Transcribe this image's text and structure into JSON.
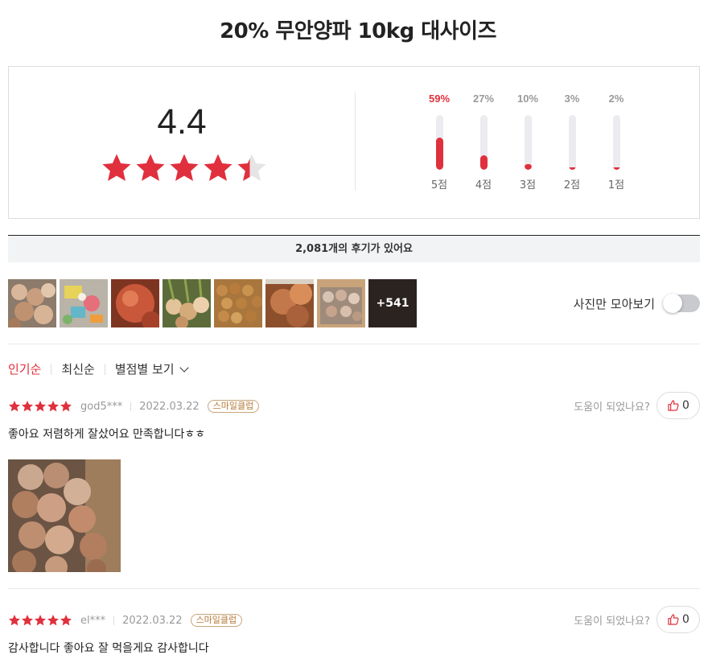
{
  "product": {
    "title": "20% 무안양파 10kg 대사이즈"
  },
  "summary": {
    "average": "4.4",
    "average_stars": 4.4,
    "distribution": [
      {
        "pct": "59%",
        "label": "5점",
        "value": 0.59,
        "highlight": true
      },
      {
        "pct": "27%",
        "label": "4점",
        "value": 0.27,
        "highlight": false
      },
      {
        "pct": "10%",
        "label": "3점",
        "value": 0.1,
        "highlight": false
      },
      {
        "pct": "3%",
        "label": "2점",
        "value": 0.03,
        "highlight": false
      },
      {
        "pct": "2%",
        "label": "1점",
        "value": 0.02,
        "highlight": false
      }
    ]
  },
  "count_text": "2,081개의 후기가 있어요",
  "photos": {
    "more_label": "+541",
    "toggle_label": "사진만 모아보기",
    "toggle_on": false
  },
  "sort": {
    "popular": "인기순",
    "latest": "최신순",
    "by_rating": "별점별 보기"
  },
  "reviews": [
    {
      "stars": 5,
      "user": "god5***",
      "date": "2022.03.22",
      "badge": "스마일클럽",
      "text": "좋아요 저렴하게 잘샀어요 만족합니다ㅎㅎ",
      "helpful_q": "도움이 되었나요?",
      "likes": "0",
      "has_photo": true
    },
    {
      "stars": 5,
      "user": "el***",
      "date": "2022.03.22",
      "badge": "스마일클럽",
      "text": "감사합니다 좋아요 잘 먹을게요 감사합니다",
      "helpful_q": "도움이 되었나요?",
      "likes": "0",
      "has_photo": false
    }
  ],
  "colors": {
    "accent": "#e0303d",
    "star_empty": "#e5e5e5"
  }
}
